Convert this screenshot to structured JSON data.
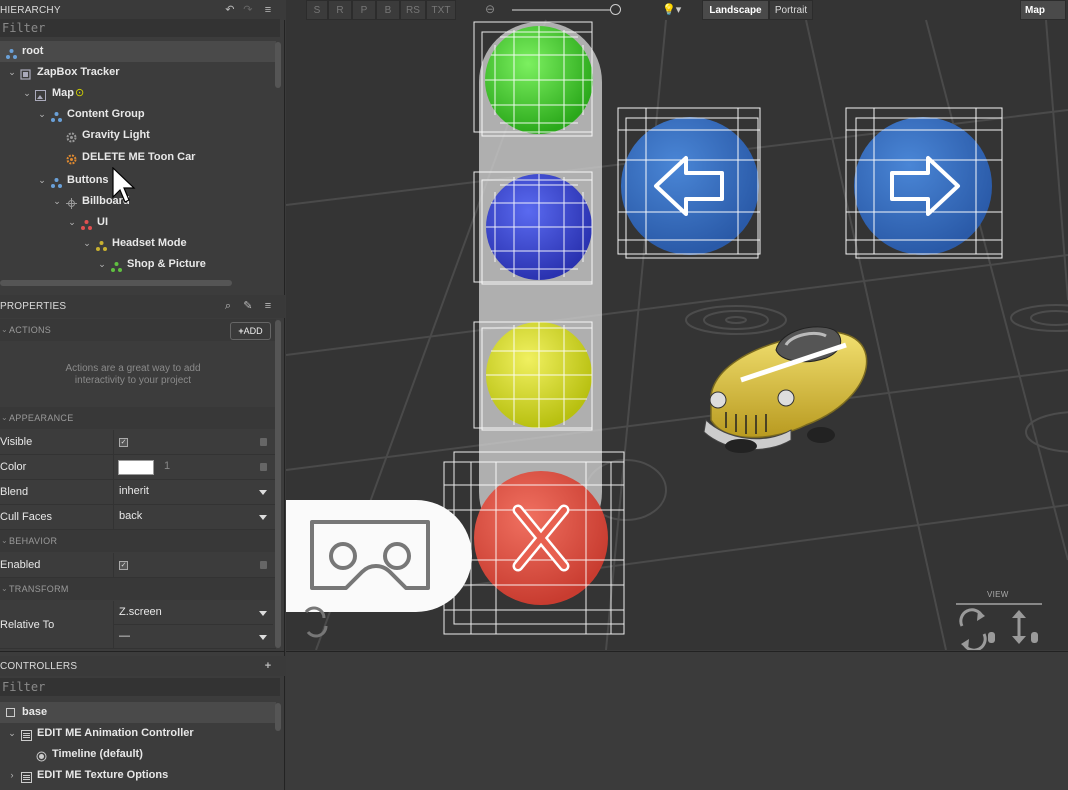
{
  "hierarchy": {
    "title": "HIERARCHY",
    "filter_placeholder": "Filter",
    "items": [
      {
        "label": "root"
      },
      {
        "label": "ZapBox Tracker"
      },
      {
        "label": "Map"
      },
      {
        "label": "Content Group"
      },
      {
        "label": "Gravity Light"
      },
      {
        "label": "DELETE ME Toon Car"
      },
      {
        "label": "Buttons"
      },
      {
        "label": "Billboard"
      },
      {
        "label": "UI"
      },
      {
        "label": "Headset Mode"
      },
      {
        "label": "Shop & Picture"
      }
    ]
  },
  "properties": {
    "title": "PROPERTIES",
    "actions": {
      "section": "ACTIONS",
      "add_label": "ADD",
      "empty_line1": "Actions are a great way to add",
      "empty_line2": "interactivity to your project"
    },
    "appearance": {
      "section": "APPEARANCE",
      "visible_label": "Visible",
      "color_label": "Color",
      "color_value": "#ffffff",
      "opacity_value": "1",
      "blend_label": "Blend",
      "blend_value": "inherit",
      "cull_label": "Cull Faces",
      "cull_value": "back"
    },
    "behavior": {
      "section": "BEHAVIOR",
      "enabled_label": "Enabled"
    },
    "transform": {
      "section": "TRANSFORM",
      "relative_label": "Relative To",
      "relative_value": "Z.screen",
      "relative_value2": "—"
    }
  },
  "controllers": {
    "title": "CONTROLLERS",
    "filter_placeholder": "Filter",
    "items": [
      {
        "label": "base"
      },
      {
        "label": "EDIT ME Animation Controller"
      },
      {
        "label": "Timeline (default)"
      },
      {
        "label": "EDIT ME Texture Options"
      }
    ]
  },
  "toolbar": {
    "modes": [
      "S",
      "R",
      "P",
      "B",
      "RS",
      "TXT"
    ],
    "landscape": "Landscape",
    "portrait": "Portrait",
    "view_select": "Map"
  },
  "viewport": {
    "view_label": "VIEW"
  }
}
